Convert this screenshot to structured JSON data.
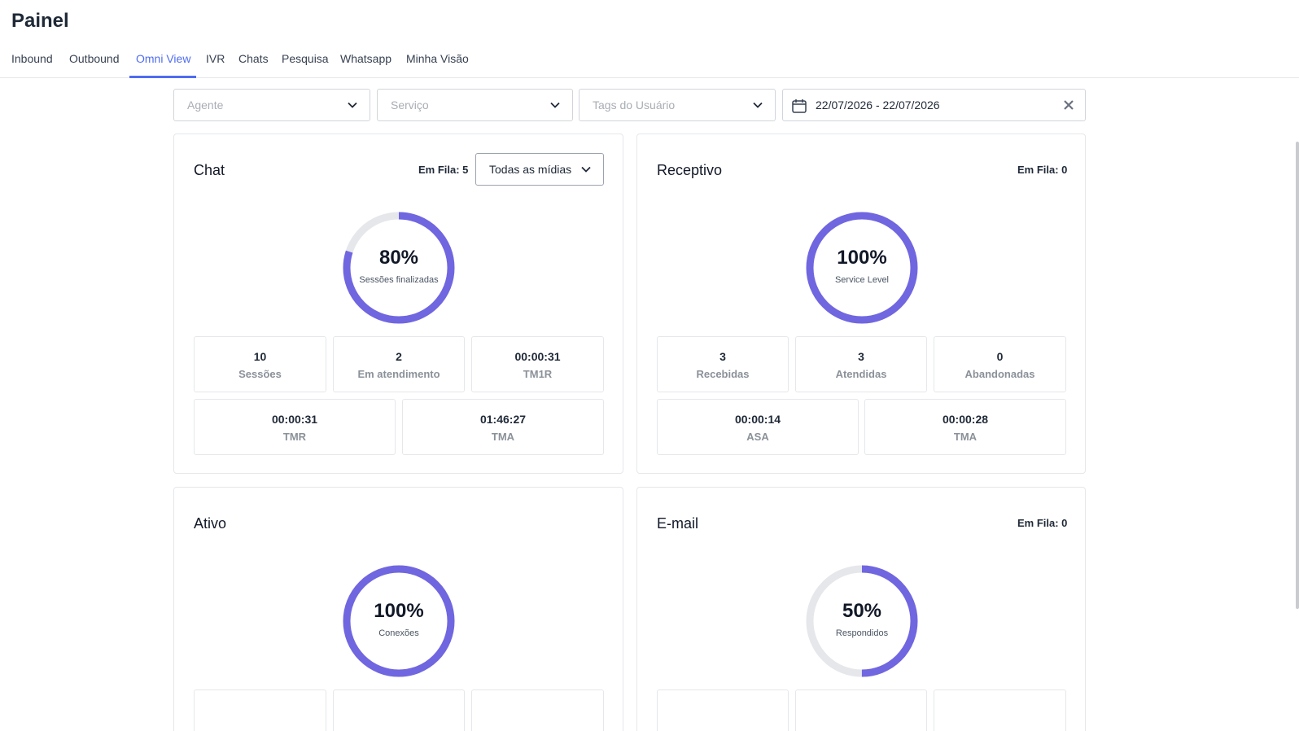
{
  "page": {
    "title": "Painel"
  },
  "tabs": [
    {
      "label": "Inbound"
    },
    {
      "label": "Outbound"
    },
    {
      "label": "Omni View",
      "active": true
    },
    {
      "label": "IVR"
    },
    {
      "label": "Chats"
    },
    {
      "label": "Pesquisa"
    },
    {
      "label": "Whatsapp"
    },
    {
      "label": "Minha Visão"
    }
  ],
  "filters": {
    "agent_placeholder": "Agente",
    "service_placeholder": "Serviço",
    "tags_placeholder": "Tags do Usuário",
    "date_range": "22/07/2026 - 22/07/2026"
  },
  "colors": {
    "accent": "#4f6cf0",
    "ring": "#7066e0",
    "ring_track": "#e5e7eb"
  },
  "cards": {
    "chat": {
      "title": "Chat",
      "queue": "Em Fila: 5",
      "media_select": "Todas as mídias",
      "percent": 80,
      "percent_label": "80%",
      "ring_label": "Sessões finalizadas",
      "stats": [
        {
          "value": "10",
          "label": "Sessões"
        },
        {
          "value": "2",
          "label": "Em atendimento"
        },
        {
          "value": "00:00:31",
          "label": "TM1R"
        },
        {
          "value": "00:00:31",
          "label": "TMR"
        },
        {
          "value": "01:46:27",
          "label": "TMA"
        }
      ]
    },
    "receptivo": {
      "title": "Receptivo",
      "queue": "Em Fila: 0",
      "percent": 100,
      "percent_label": "100%",
      "ring_label": "Service Level",
      "stats": [
        {
          "value": "3",
          "label": "Recebidas"
        },
        {
          "value": "3",
          "label": "Atendidas"
        },
        {
          "value": "0",
          "label": "Abandonadas"
        },
        {
          "value": "00:00:14",
          "label": "ASA"
        },
        {
          "value": "00:00:28",
          "label": "TMA"
        }
      ]
    },
    "ativo": {
      "title": "Ativo",
      "percent": 100,
      "percent_label": "100%",
      "ring_label": "Conexões"
    },
    "email": {
      "title": "E-mail",
      "queue": "Em Fila: 0",
      "percent": 50,
      "percent_label": "50%",
      "ring_label": "Respondidos"
    }
  }
}
